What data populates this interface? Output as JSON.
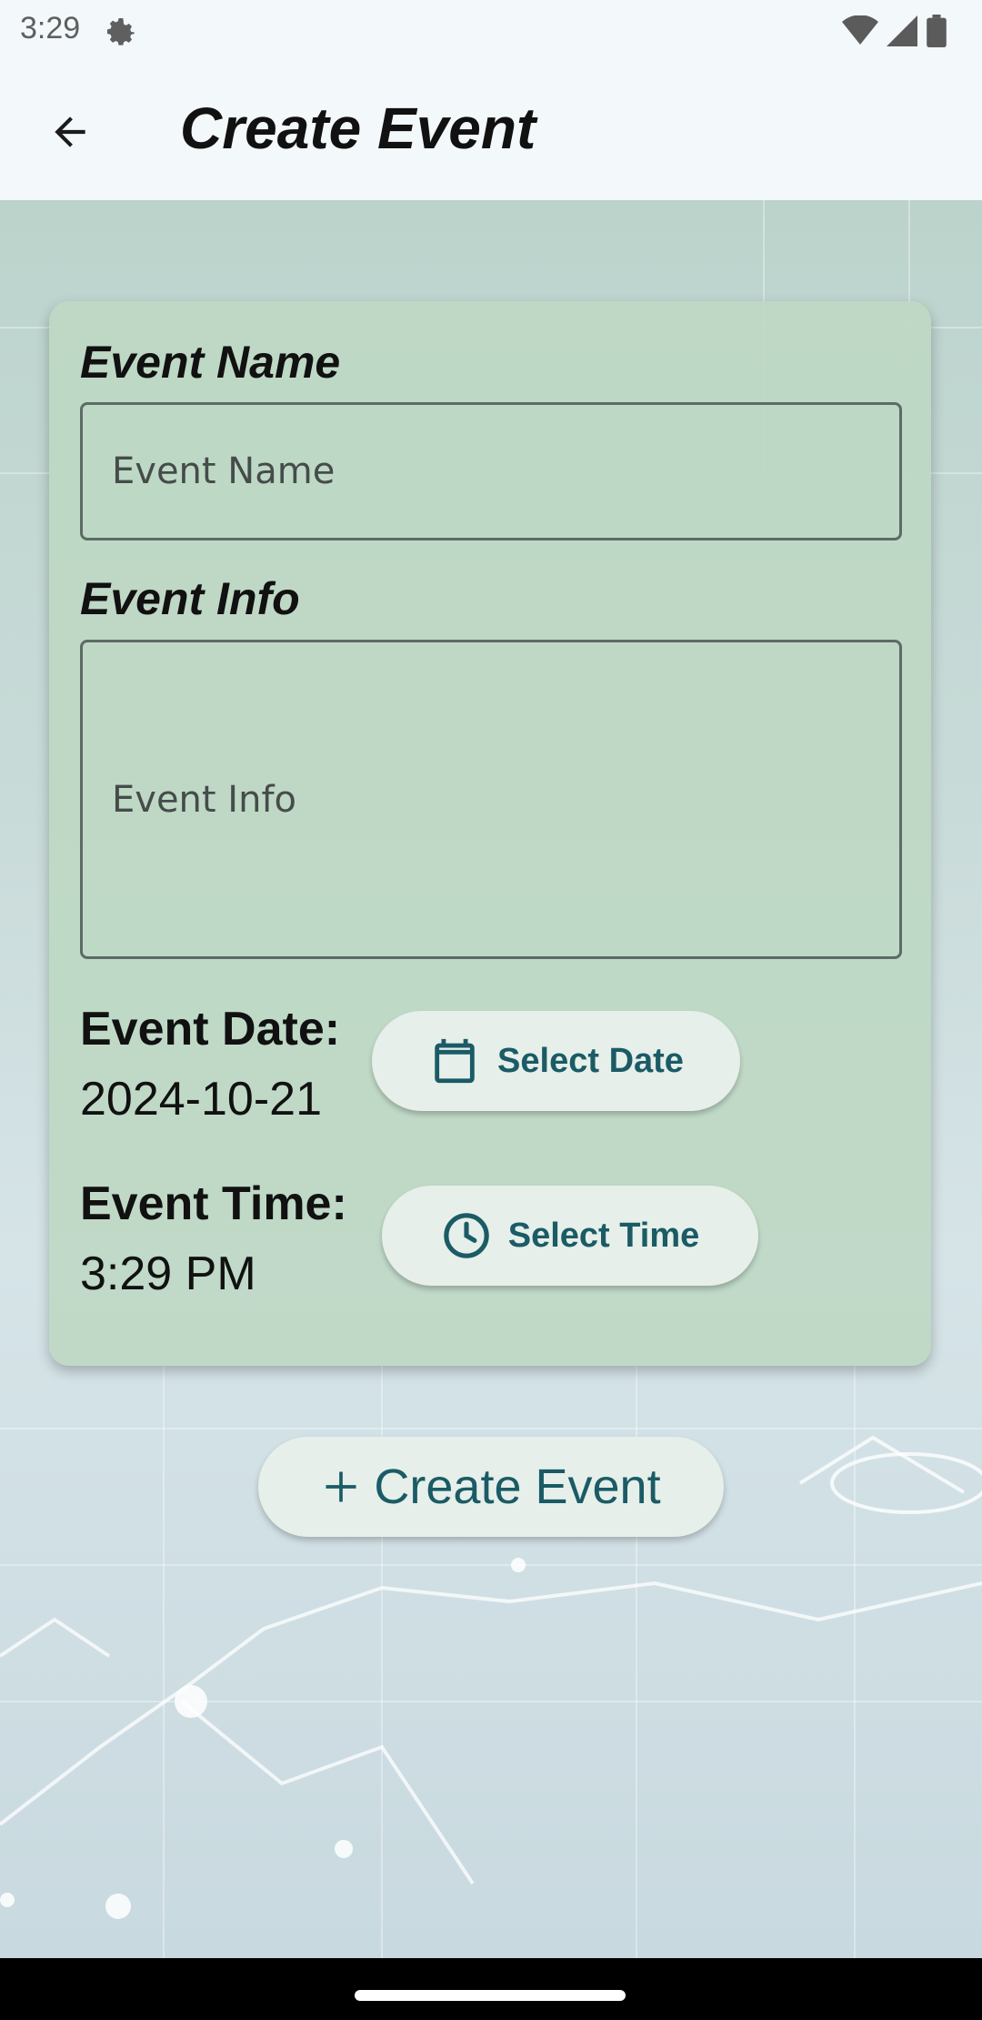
{
  "status_bar": {
    "time": "3:29",
    "icons": [
      "settings-gear-icon",
      "wifi-icon",
      "cellular-signal-icon",
      "battery-icon"
    ]
  },
  "app_bar": {
    "title": "Create Event",
    "back_icon": "arrow-left-icon"
  },
  "form": {
    "event_name_label": "Event Name",
    "event_name_placeholder": "Event Name",
    "event_info_label": "Event Info",
    "event_info_placeholder": "Event Info",
    "event_date_label": "Event Date:",
    "event_date_value": "2024-10-21",
    "select_date_label": "Select Date",
    "select_date_icon": "calendar-icon",
    "event_time_label": "Event Time:",
    "event_time_value": "3:29 PM",
    "select_time_label": "Select Time",
    "select_time_icon": "clock-icon"
  },
  "actions": {
    "create_event_label": "Create Event",
    "create_event_icon": "plus-icon"
  },
  "colors": {
    "accent": "#1a5b66",
    "card_background": "#bed8c4",
    "button_background": "#e6efe9"
  }
}
